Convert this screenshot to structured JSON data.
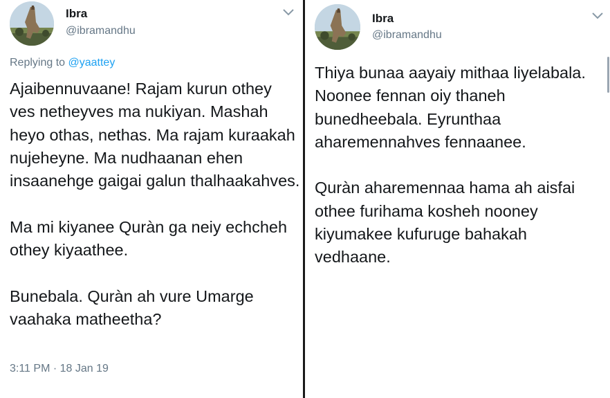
{
  "left_tweet": {
    "author_name": "Ibra",
    "author_handle": "@ibramandhu",
    "reply_prefix": "Replying to",
    "reply_handle": "@yaattey",
    "paragraphs": [
      "Ajaibennuvaane! Rajam kurun othey ves netheyves ma nukiyan. Mashah heyo othas, nethas. Ma rajam kuraakah nujeheyne. Ma nudhaanan ehen insaanehge gaigai galun thalhaakahves.",
      "Ma mi kiyanee Quràn ga neiy echcheh othey kiyaathee.",
      "Bunebala. Quràn ah vure Umarge vaahaka matheetha?"
    ],
    "timestamp": "3:11 PM · 18 Jan 19",
    "icons": {
      "avatar": "profile-photo",
      "menu": "chevron-down-icon"
    }
  },
  "right_tweet": {
    "author_name": "Ibra",
    "author_handle": "@ibramandhu",
    "paragraphs": [
      "Thiya bunaa aayaiy mithaa liyelabala. Noonee fennan oiy thaneh bunedheebala. Eyrunthaa aharemennahves fennaanee.",
      "Quràn aharemennaa hama ah aisfai othee furihama kosheh nooney kiyumakee kufuruge bahakah vedhaane."
    ],
    "icons": {
      "avatar": "profile-photo",
      "menu": "chevron-down-icon"
    }
  },
  "colors": {
    "text": "#14171a",
    "secondary": "#657786",
    "link": "#1da1f2",
    "divider": "#1a1a1a"
  }
}
